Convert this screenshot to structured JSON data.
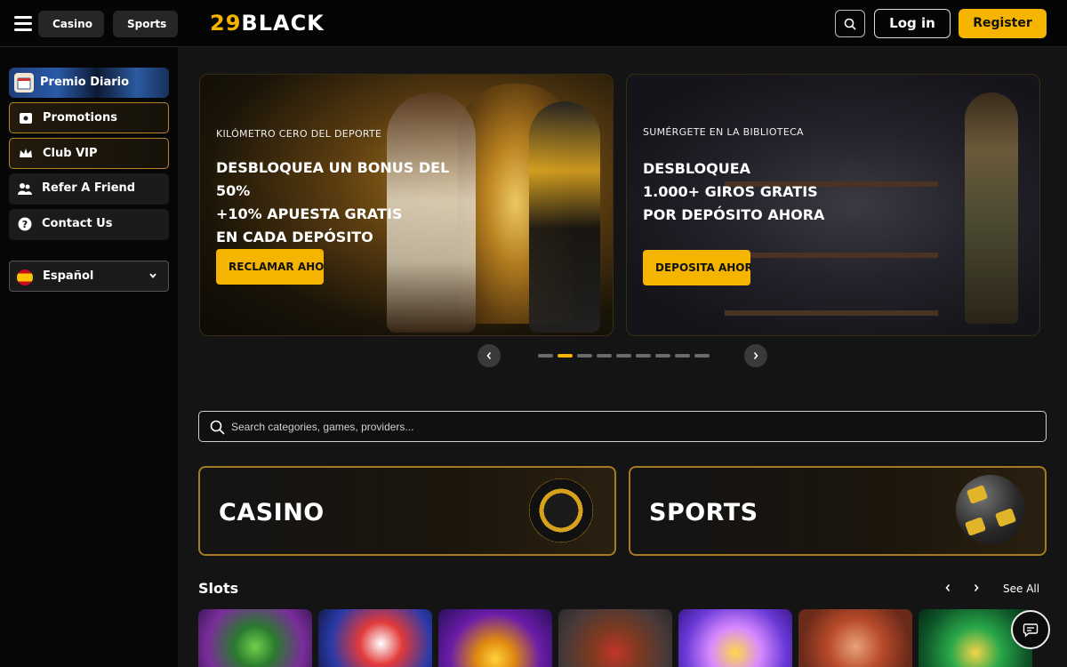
{
  "header": {
    "tabs": [
      {
        "label": "Casino"
      },
      {
        "label": "Sports"
      }
    ],
    "logo": {
      "number": "29",
      "text": "BLACK"
    },
    "login_label": "Log in",
    "register_label": "Register"
  },
  "sidebar": {
    "promo_banner": {
      "label": "Premio Diario",
      "icon": "calendar-icon"
    },
    "items": [
      {
        "label": "Promotions",
        "icon": "gift-card-icon"
      },
      {
        "label": "Club VIP",
        "icon": "crown-icon"
      },
      {
        "label": "Refer A Friend",
        "icon": "users-icon"
      },
      {
        "label": "Contact Us",
        "icon": "help-circle-icon"
      }
    ],
    "language": {
      "label": "Español",
      "icon": "spain-flag-icon"
    }
  },
  "banners": [
    {
      "kicker": "KILÓMETRO CERO DEL DEPORTE",
      "title_lines": [
        "DESBLOQUEA UN BONUS DEL 50%",
        "+10% APUESTA GRATIS",
        "EN CADA DEPÓSITO"
      ],
      "cta": "RECLAMAR AHORA"
    },
    {
      "kicker": "SUMÉRGETE EN LA BIBLIOTECA",
      "title_lines": [
        "DESBLOQUEA",
        "1.000+ GIROS GRATIS",
        "POR DEPÓSITO AHORA"
      ],
      "cta": "DEPOSITA AHORA"
    }
  ],
  "carousel": {
    "dot_count": 9,
    "active_index": 1
  },
  "search": {
    "placeholder": "Search categories, games, providers..."
  },
  "categories": [
    {
      "label": "CASINO"
    },
    {
      "label": "SPORTS"
    }
  ],
  "slots": {
    "title": "Slots",
    "see_all": "See All"
  },
  "colors": {
    "accent": "#f5b400",
    "background": "#141414",
    "sidebar": "#060606"
  }
}
